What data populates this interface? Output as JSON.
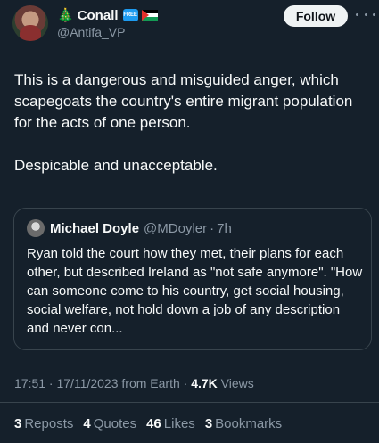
{
  "author": {
    "tree_emoji": "🎄",
    "display_name": "Conall",
    "badge": "FREE",
    "handle": "@Antifa_VP"
  },
  "header": {
    "follow_label": "Follow"
  },
  "tweet": {
    "text": "This is a dangerous and misguided anger, which scapegoats the country's entire migrant population for the acts of one person.\n\nDespicable and unacceptable."
  },
  "quote": {
    "name": "Michael Doyle",
    "handle": "@MDoyler",
    "dot": "·",
    "time": "7h",
    "text": "Ryan told the court how they met, their plans for each other, but described Ireland as \"not safe anymore\". \"How can someone come to his country, get social housing, social welfare, not hold down a job of any description and never con..."
  },
  "meta": {
    "time_date": "17:51 · 17/11/2023 from Earth ·",
    "views_count": "4.7K",
    "views_label": "Views"
  },
  "stats": [
    {
      "count": "3",
      "label": "Reposts"
    },
    {
      "count": "4",
      "label": "Quotes"
    },
    {
      "count": "46",
      "label": "Likes"
    },
    {
      "count": "3",
      "label": "Bookmarks"
    }
  ],
  "colors": {
    "background": "#15202b",
    "text": "#f7f9f9",
    "secondary": "#8b98a5",
    "border": "#38444d",
    "accent": "#1d9bf0"
  }
}
